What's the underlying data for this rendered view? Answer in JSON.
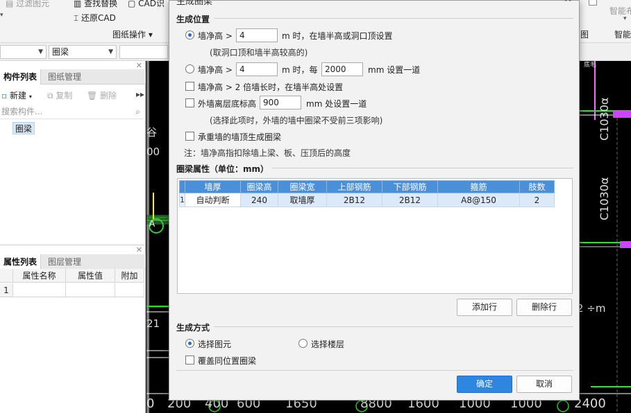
{
  "ribbon": {
    "filter_layer": "过滤图元",
    "find_replace": "查找替换",
    "cad_recog": "CAD识",
    "restore_cad": "还原CAD",
    "drawing_ops": "图纸操作",
    "right_label": "智能布",
    "right_label2": "智能",
    "right_label3": "图"
  },
  "combos": {
    "first": "",
    "second": "圈梁"
  },
  "component_panel": {
    "tabs": [
      "构件列表",
      "图纸管理"
    ],
    "new": "新建",
    "copy": "复制",
    "delete": "删除",
    "search_placeholder": "搜索构件...",
    "items": [
      "圈梁"
    ]
  },
  "property_panel": {
    "tabs": [
      "属性列表",
      "图层管理"
    ],
    "headers": [
      "属性名称",
      "属性值",
      "附加"
    ],
    "row_number": "1"
  },
  "dialog": {
    "title": "生成圈梁",
    "section_position": "生成位置",
    "opt1_label": "墙净高 >",
    "opt1_value": "4",
    "opt1_suffix": "m 时，在墙半高或洞口顶设置",
    "opt1_note": "(取洞口顶和墙半高较高的)",
    "opt2_label": "墙净高 >",
    "opt2_value": "4",
    "opt2_mid": "m 时，每",
    "opt2_value2": "2000",
    "opt2_suffix": "mm 设置一道",
    "opt3_label": "墙净高 > 2 倍墙长时，在墙半高处设置",
    "opt4_label": "外墙离层底标高",
    "opt4_value": "900",
    "opt4_suffix": "mm 处设置一道",
    "opt4_note": "(选择此项时，外墙的墙中圈梁不受前三项影响)",
    "opt5_label": "承重墙的墙顶生成圈梁",
    "note": "注：墙净高指扣除墙上梁、板、压顶后的高度",
    "section_props": "圈梁属性（单位：mm）",
    "grid_headers": [
      "墙厚",
      "圈梁高",
      "圈梁宽",
      "上部钢筋",
      "下部钢筋",
      "箍筋",
      "肢数"
    ],
    "grid_rows": [
      {
        "no": "1",
        "cells": [
          "自动判断",
          "240",
          "取墙厚",
          "2B12",
          "2B12",
          "A8@150",
          "2"
        ]
      }
    ],
    "add_row": "添加行",
    "delete_row": "删除行",
    "section_method": "生成方式",
    "method1": "选择图元",
    "method2": "选择楼层",
    "overwrite": "覆盖同位置圈梁",
    "ok": "确定",
    "cancel": "取消"
  },
  "cad": {
    "bottom_labels": [
      "0",
      "200",
      "400",
      "600",
      "1650",
      "8800",
      "1600",
      "1000",
      "1000",
      "2400"
    ],
    "side_labels": [
      "C1030α",
      "C1030α"
    ],
    "axis_a": "A",
    "left_labels": [
      "谷",
      "00",
      "21"
    ],
    "right_label": "2 ÷m",
    "small": "底毛"
  },
  "colors": {
    "accent": "#2f86e0",
    "grid_header": "#4a90d9",
    "selected_row": "#dbe9f9",
    "cad_bg": "#000000"
  }
}
